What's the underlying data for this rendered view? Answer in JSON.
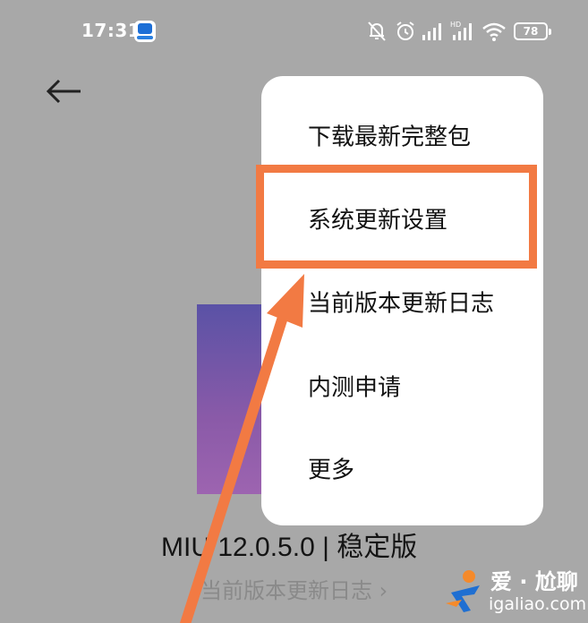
{
  "status_bar": {
    "time": "17:31",
    "battery": "78",
    "icons": [
      "app-badge-icon",
      "do-not-disturb-off-icon",
      "alarm-icon",
      "signal-icon",
      "hd-signal-icon",
      "wifi-icon",
      "battery-icon"
    ]
  },
  "back_icon": "arrow-left-icon",
  "menu": {
    "items": [
      {
        "label": "下载最新完整包"
      },
      {
        "label": "系统更新设置"
      },
      {
        "label": "当前版本更新日志"
      },
      {
        "label": "内测申请"
      },
      {
        "label": "更多"
      }
    ],
    "highlighted_index": 1
  },
  "main": {
    "version": "MIU  12.0.5.0 | 稳定版",
    "changelog_link": "当前版本更新日志 ›"
  },
  "annotation": {
    "color": "#f27a43",
    "arrow_icon": "pointer-arrow"
  },
  "watermark": {
    "text": "爱 · 尬聊",
    "url": "igaliao.com"
  },
  "colors": {
    "background_dim": "#a8a8a8",
    "menu_bg": "#ffffff",
    "highlight": "#f27a43"
  }
}
